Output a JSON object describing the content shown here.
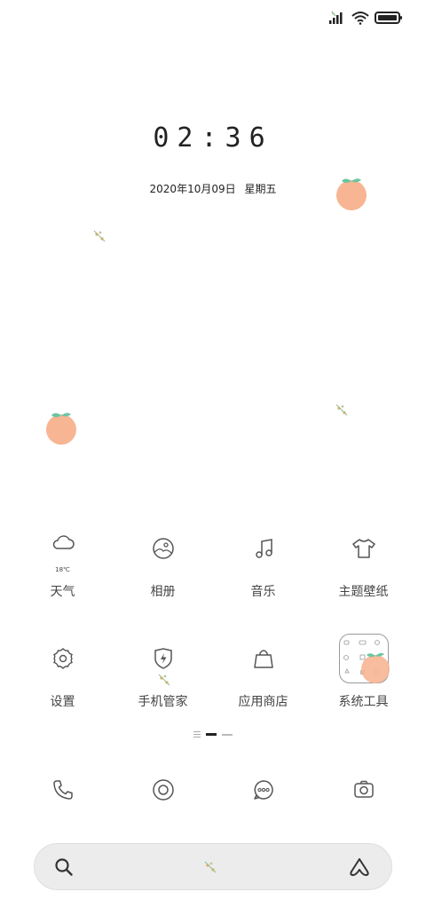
{
  "status_bar": {
    "icons": [
      "signal-icon",
      "wifi-icon",
      "battery-icon"
    ]
  },
  "lockscreen": {
    "time": "02:36",
    "date": "2020年10月09日",
    "weekday": "星期五"
  },
  "apps": [
    {
      "label": "天气",
      "icon": "weather-cloud-icon",
      "temp": "18℃"
    },
    {
      "label": "相册",
      "icon": "gallery-icon"
    },
    {
      "label": "音乐",
      "icon": "music-note-icon"
    },
    {
      "label": "主题壁纸",
      "icon": "shirt-icon"
    },
    {
      "label": "设置",
      "icon": "settings-flower-icon"
    },
    {
      "label": "手机管家",
      "icon": "shield-icon"
    },
    {
      "label": "应用商店",
      "icon": "shopping-bag-icon"
    },
    {
      "label": "系统工具",
      "icon": "folder-icon"
    }
  ],
  "dock": [
    "phone-icon",
    "browser-icon",
    "messages-icon",
    "camera-icon"
  ],
  "colors": {
    "peach": "#f7b593",
    "leaf": "#6cc5a0",
    "icon_stroke": "#555555",
    "search_bg": "#ececec"
  }
}
